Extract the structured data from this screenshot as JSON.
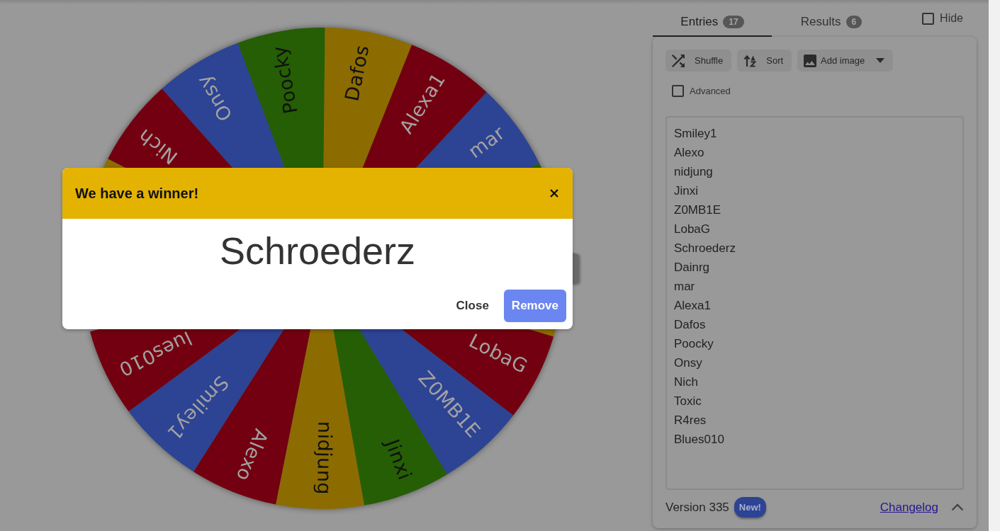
{
  "wheel": {
    "segments": [
      {
        "color": "#8c6c00"
      },
      {
        "label": "Nich",
        "color": "#730010"
      },
      {
        "label": "Onsy",
        "color": "#2d4393"
      },
      {
        "label": "Poocky",
        "color": "#255e04"
      },
      {
        "label": "Dafos",
        "color": "#8c6c00"
      },
      {
        "label": "Alexa1",
        "color": "#730010"
      },
      {
        "label": "mar",
        "color": "#2d4393"
      },
      {
        "color": "#255e04"
      },
      {
        "color": "#8c6c00"
      },
      {
        "label": "LobaG",
        "color": "#730010"
      },
      {
        "label": "Z0MB1E",
        "color": "#2d4393"
      },
      {
        "label": "Jinxi",
        "color": "#255e04"
      },
      {
        "label": "nidjung",
        "color": "#8c6c00"
      },
      {
        "label": "Alexo",
        "color": "#730010"
      },
      {
        "label": "Smiley1",
        "color": "#2d4393"
      },
      {
        "label": "lues010",
        "color": "#730010"
      }
    ]
  },
  "winner_dialog": {
    "title": "We have a winner!",
    "winner": "Schroederz",
    "buttons": [
      {
        "label": "Close",
        "kind": "text"
      },
      {
        "label": "Remove",
        "kind": "primary"
      }
    ]
  },
  "tabs": [
    {
      "label": "Entries",
      "count": "17",
      "selected": true
    },
    {
      "label": "Results",
      "count": "6",
      "selected": false
    }
  ],
  "hide_toggle": {
    "label": "Hide",
    "checked": false
  },
  "toolbar": [
    {
      "label": "Shuffle",
      "kind": "shuffle",
      "dropdown": false
    },
    {
      "label": "Sort",
      "kind": "sort",
      "dropdown": false
    },
    {
      "label": "Add image",
      "kind": "image",
      "dropdown": true
    }
  ],
  "advanced": {
    "label": "Advanced",
    "checked": false
  },
  "entries": [
    "Smiley1",
    "Alexo",
    "nidjung",
    "Jinxi",
    "Z0MB1E",
    "LobaG",
    "Schroederz",
    "Dainrg",
    "mar",
    "Alexa1",
    "Dafos",
    "Poocky",
    "Onsy",
    "Nich",
    "Toxic",
    "R4res",
    "Blues010"
  ],
  "footer": {
    "version": "Version 335",
    "badge": "New!",
    "link": "Changelog"
  }
}
